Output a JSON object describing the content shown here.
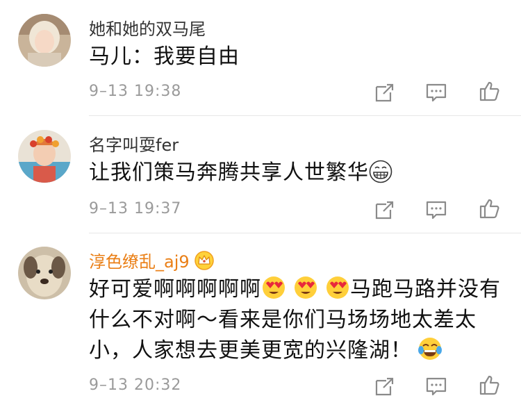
{
  "comments": [
    {
      "username": "她和她的双马尾",
      "text": "马儿：我要自由",
      "time": "9–13 19:38"
    },
    {
      "username": "名字叫耍fer",
      "text": "让我们策马奔腾共享人世繁华",
      "time": "9–13 19:37"
    },
    {
      "username": "淳色缭乱_aj9",
      "text_part1": "好可爱啊啊啊啊啊",
      "text_part2": "马跑马路并没有",
      "text_line2": "什么不对啊～看来是你们马场场地太差太",
      "text_line3": "小，人家想去更美更宽的兴隆湖！",
      "time": "9–13 20:32"
    }
  ],
  "icons": {
    "repost": "repost-icon",
    "comment": "comment-icon",
    "like": "like-icon"
  },
  "colors": {
    "vip_name": "#ea7f16",
    "timestamp": "#9a9a9a",
    "icon": "#8a8a8a"
  }
}
